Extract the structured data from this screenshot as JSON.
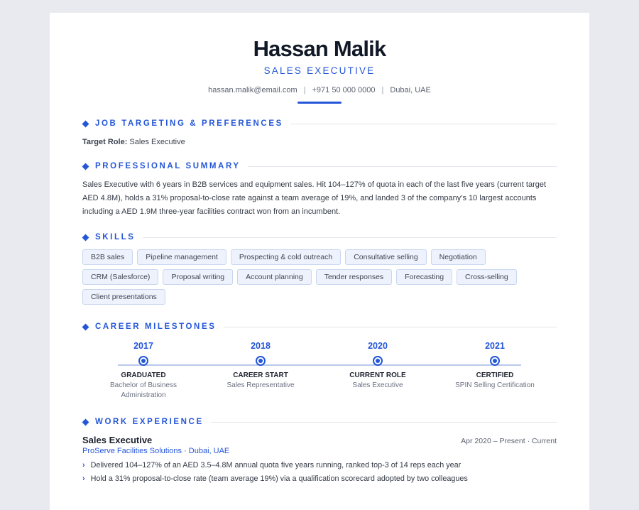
{
  "header": {
    "name": "Hassan Malik",
    "title": "SALES EXECUTIVE",
    "email": "hassan.malik@email.com",
    "phone": "+971 50 000 0000",
    "location": "Dubai, UAE",
    "separator": "|"
  },
  "sections": {
    "targeting": "JOB TARGETING & PREFERENCES",
    "summary": "PROFESSIONAL SUMMARY",
    "skills": "SKILLS",
    "milestones": "CAREER MILESTONES",
    "experience": "WORK EXPERIENCE"
  },
  "targeting": {
    "label": "Target Role:",
    "value": "Sales Executive"
  },
  "summary": "Sales Executive with 6 years in B2B services and equipment sales. Hit 104–127% of quota in each of the last five years (current target AED 4.8M), holds a 31% proposal-to-close rate against a team average of 19%, and landed 3 of the company’s 10 largest accounts including a AED 1.9M three-year facilities contract won from an incumbent.",
  "skills": [
    "B2B sales",
    "Pipeline management",
    "Prospecting & cold outreach",
    "Consultative selling",
    "Negotiation",
    "CRM (Salesforce)",
    "Proposal writing",
    "Account planning",
    "Tender responses",
    "Forecasting",
    "Cross-selling",
    "Client presentations"
  ],
  "milestones": [
    {
      "year": "2017",
      "label": "GRADUATED",
      "desc": "Bachelor of Business Administration"
    },
    {
      "year": "2018",
      "label": "CAREER START",
      "desc": "Sales Representative"
    },
    {
      "year": "2020",
      "label": "CURRENT ROLE",
      "desc": "Sales Executive"
    },
    {
      "year": "2021",
      "label": "CERTIFIED",
      "desc": "SPIN Selling Certification"
    }
  ],
  "experience": [
    {
      "title": "Sales Executive",
      "dates": "Apr 2020 – Present · Current",
      "company": "ProServe Facilities Solutions · Dubai, UAE",
      "bullets": [
        "Delivered 104–127% of an AED 3.5–4.8M annual quota five years running, ranked top-3 of 14 reps each year",
        "Hold a 31% proposal-to-close rate (team average 19%) via a qualification scorecard adopted by two colleagues"
      ]
    }
  ],
  "colors": {
    "accent": "#2456d8",
    "chip_bg": "#edf2fc",
    "chip_border": "#c9d6ef"
  }
}
